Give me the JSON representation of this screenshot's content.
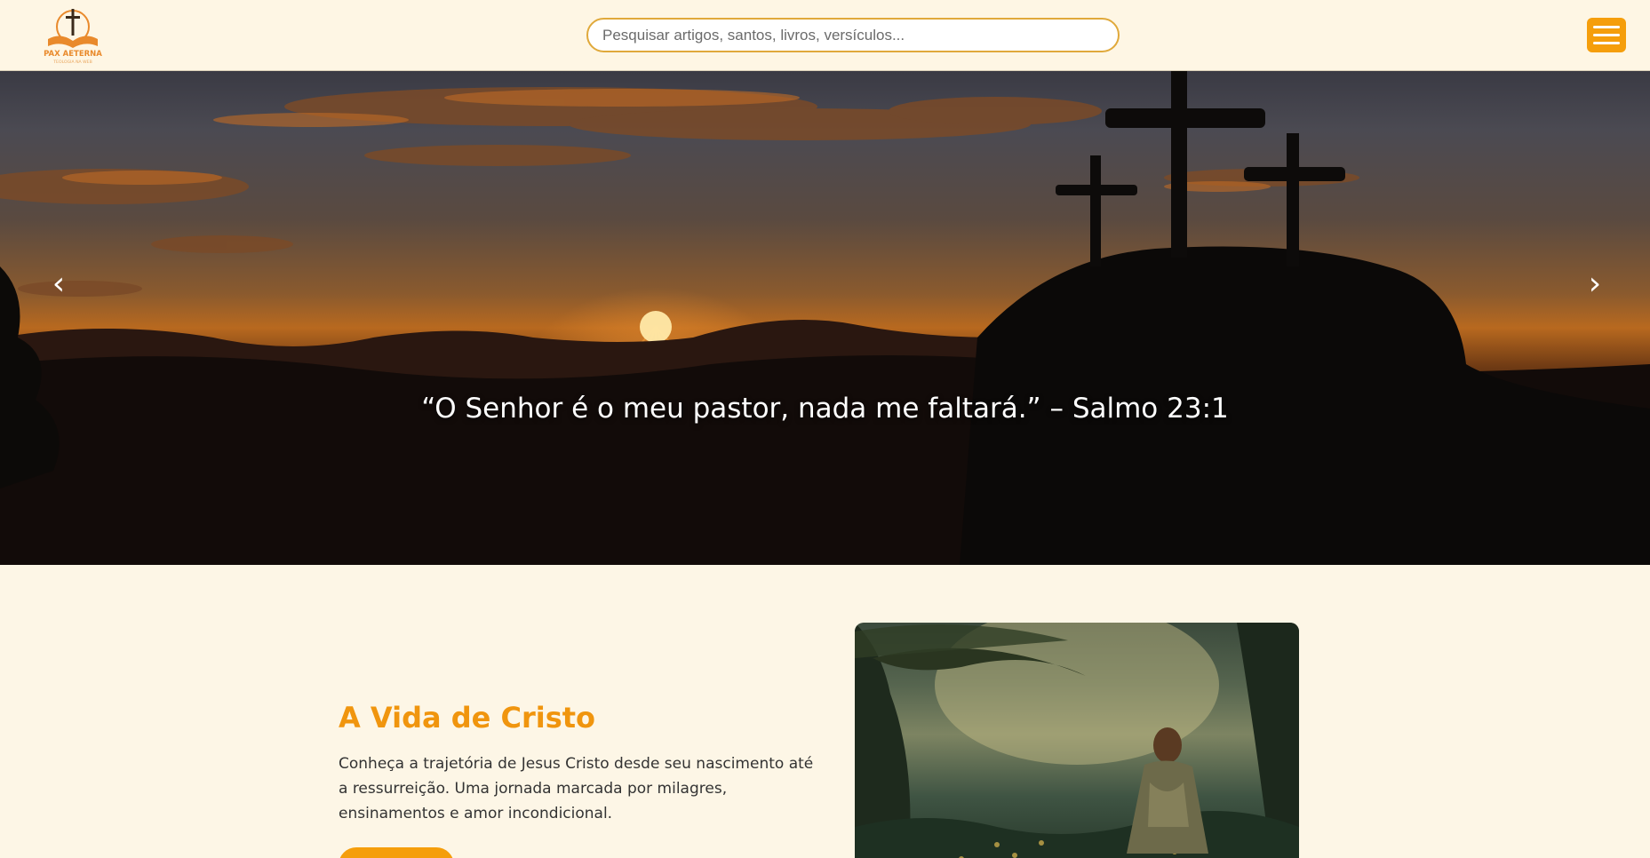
{
  "header": {
    "logo": {
      "brand": "PAX AETERNA",
      "tagline": "TEOLOGIA NA WEB",
      "icon": "cross-book-logo-icon",
      "color": "#e98a2c"
    },
    "search": {
      "placeholder": "Pesquisar artigos, santos, livros, versículos...",
      "value": ""
    },
    "menu": {
      "icon": "hamburger-menu-icon",
      "color": "#f59e0b"
    }
  },
  "hero": {
    "quote": "“O Senhor é o meu pastor, nada me faltará.” – Salmo 23:1",
    "prev_arrow": "‹",
    "next_arrow": "›",
    "image": "sunset-three-crosses-hill"
  },
  "feature": {
    "title": "A Vida de Cristo",
    "description": "Conheça a trajetória de Jesus Cristo desde seu nascimento até a ressurreição. Uma jornada marcada por milagres, ensinamentos e amor incondicional.",
    "image": "jesus-in-garden",
    "accent_color": "#f0950e"
  }
}
